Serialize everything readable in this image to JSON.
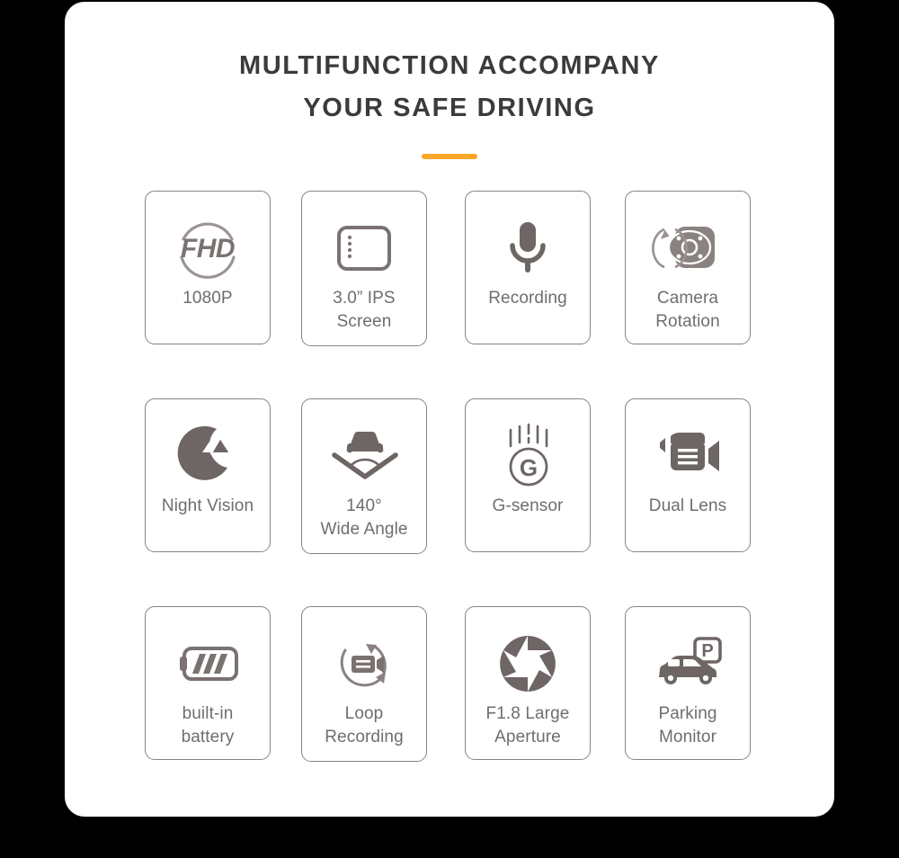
{
  "heading": {
    "line1": "MULTIFUNCTION ACCOMPANY",
    "line2": "YOUR SAFE DRIVING"
  },
  "colors": {
    "accent": "#fba628",
    "card_border": "#8c8280",
    "icon": "#6e6664",
    "label_text": "#6e6e6e",
    "heading_text": "#3b3b3b",
    "panel_bg": "#ffffff",
    "page_bg": "#000000"
  },
  "features": [
    [
      {
        "icon": "fhd-1080p-icon",
        "icon_text": "FHD",
        "line1": "1080P",
        "line2": ""
      },
      {
        "icon": "ips-screen-icon",
        "line1": "3.0” IPS",
        "line2": "Screen"
      },
      {
        "icon": "microphone-icon",
        "line1": "Recording",
        "line2": ""
      },
      {
        "icon": "camera-rotation-icon",
        "line1": "Camera",
        "line2": "Rotation"
      }
    ],
    [
      {
        "icon": "night-vision-moon-icon",
        "line1": "Night Vision",
        "line2": ""
      },
      {
        "icon": "wide-angle-car-icon",
        "line1": "140°",
        "line2": "Wide Angle"
      },
      {
        "icon": "g-sensor-icon",
        "icon_text": "G",
        "line1": "G-sensor",
        "line2": ""
      },
      {
        "icon": "dual-lens-camcorder-icon",
        "line1": "Dual Lens",
        "line2": ""
      }
    ],
    [
      {
        "icon": "battery-icon",
        "line1": "built-in",
        "line2": "battery"
      },
      {
        "icon": "loop-recording-icon",
        "line1": "Loop",
        "line2": "Recording"
      },
      {
        "icon": "aperture-icon",
        "line1": "F1.8 Large",
        "line2": "Aperture"
      },
      {
        "icon": "parking-monitor-icon",
        "icon_text": "P",
        "line1": "Parking",
        "line2": "Monitor"
      }
    ]
  ]
}
